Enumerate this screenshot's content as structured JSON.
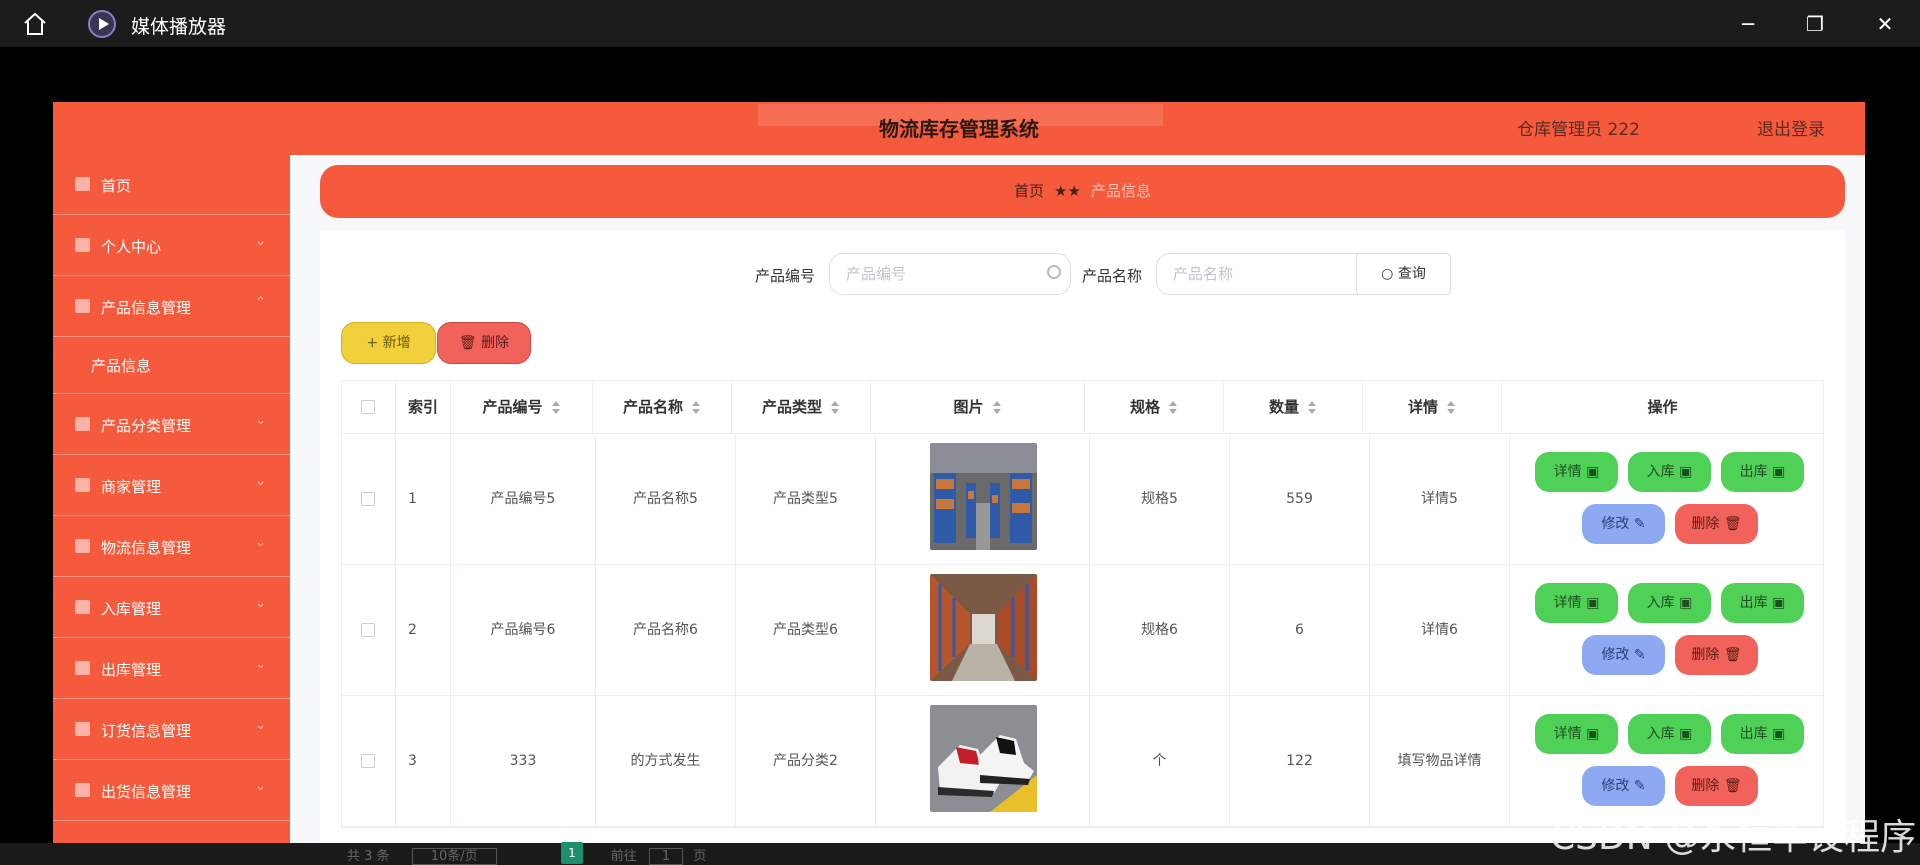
{
  "window": {
    "app_title": "媒体播放器"
  },
  "header": {
    "title": "物流库存管理系统",
    "user": "仓库管理员 222",
    "logout": "退出登录"
  },
  "sidebar": {
    "items": [
      {
        "label": "首页",
        "icon": "home-icon"
      },
      {
        "label": "个人中心",
        "icon": "user-icon"
      },
      {
        "label": "产品信息管理",
        "icon": "monitor-icon"
      },
      {
        "label": "产品信息",
        "icon": ""
      },
      {
        "label": "产品分类管理",
        "icon": "monitor-icon"
      },
      {
        "label": "商家管理",
        "icon": "card-icon"
      },
      {
        "label": "物流信息管理",
        "icon": "sliders-icon"
      },
      {
        "label": "入库管理",
        "icon": "box-icon"
      },
      {
        "label": "出库管理",
        "icon": "location-icon"
      },
      {
        "label": "订货信息管理",
        "icon": "flag-icon"
      },
      {
        "label": "出货信息管理",
        "icon": "send-icon"
      }
    ]
  },
  "breadcrumb": {
    "home": "首页",
    "separator": "★★",
    "current": "产品信息"
  },
  "search": {
    "code_label": "产品编号",
    "code_placeholder": "产品编号",
    "name_label": "产品名称",
    "name_placeholder": "产品名称",
    "query_label": "查询"
  },
  "toolbar": {
    "add_label": "新增",
    "delete_label": "删除"
  },
  "table": {
    "headers": [
      "索引",
      "产品编号",
      "产品名称",
      "产品类型",
      "图片",
      "规格",
      "数量",
      "详情",
      "操作"
    ],
    "rows": [
      {
        "index": "1",
        "code": "产品编号5",
        "name": "产品名称5",
        "type": "产品类型5",
        "image": "warehouse-shelves-image",
        "spec": "规格5",
        "qty": "559",
        "detail": "详情5"
      },
      {
        "index": "2",
        "code": "产品编号6",
        "name": "产品名称6",
        "type": "产品类型6",
        "image": "warehouse-aisle-image",
        "spec": "规格6",
        "qty": "6",
        "detail": "详情6"
      },
      {
        "index": "3",
        "code": "333",
        "name": "的方式发生",
        "type": "产品分类2",
        "image": "sneakers-image",
        "spec": "个",
        "qty": "122",
        "detail": "填写物品详情"
      }
    ],
    "actions": {
      "detail": "详情",
      "in": "入库",
      "out": "出库",
      "edit": "修改",
      "delete": "删除"
    }
  },
  "pagination": {
    "total": "共 3 条",
    "page_size": "10条/页",
    "current_page": "1",
    "goto_prefix": "前往",
    "goto_value": "1",
    "goto_suffix": "页"
  },
  "watermark": "CSDN @永恒毕设程序",
  "colors": {
    "primary": "#f55a3d",
    "green": "#4fd158",
    "blue": "#8ca9f2",
    "red": "#f0625a",
    "yellow": "#f2d03c"
  }
}
